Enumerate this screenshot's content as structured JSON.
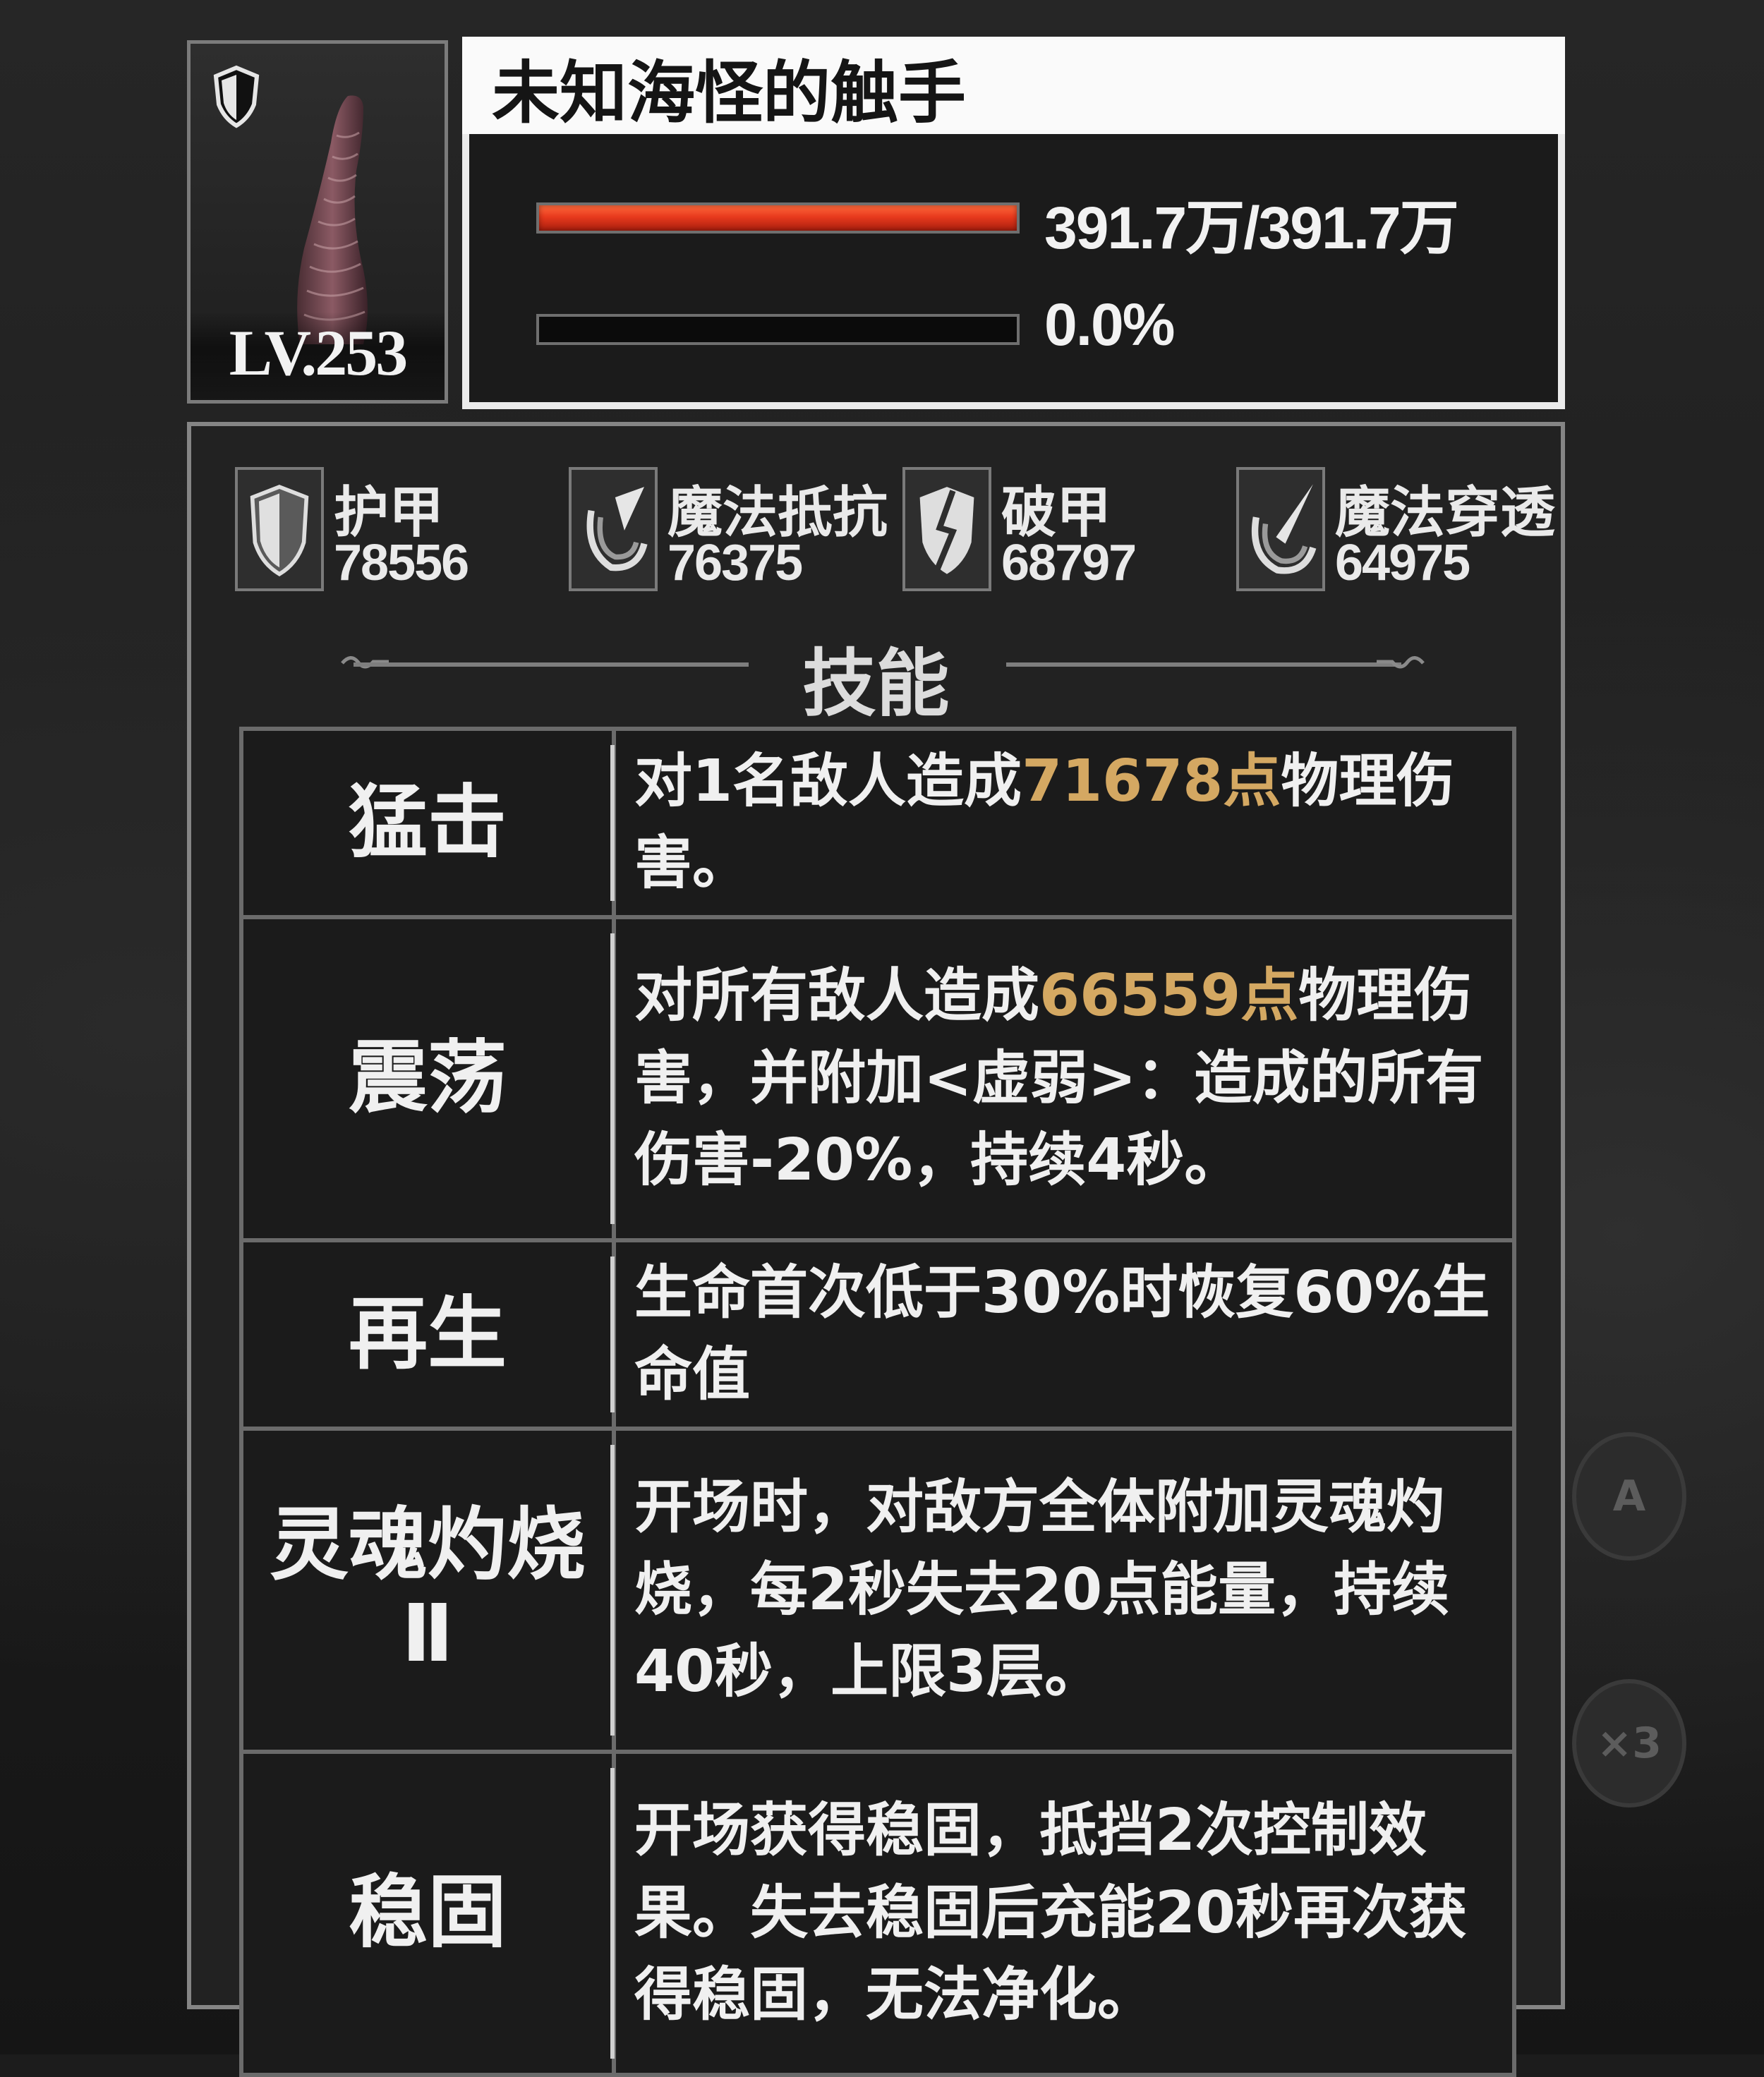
{
  "monster": {
    "name": "未知海怪的触手",
    "level": "LV.253",
    "hp_text": "391.7万/391.7万",
    "hp_fraction": 1.0,
    "energy_text": "0.0%",
    "energy_fraction": 0.0
  },
  "stats": [
    {
      "icon": "armor-shield-icon",
      "label": "护甲",
      "value": "78556"
    },
    {
      "icon": "magic-resist-icon",
      "label": "魔法抵抗",
      "value": "76375"
    },
    {
      "icon": "armor-break-icon",
      "label": "破甲",
      "value": "68797"
    },
    {
      "icon": "magic-penetration-icon",
      "label": "魔法穿透",
      "value": "64975"
    }
  ],
  "skills_heading": "技能",
  "skills": [
    {
      "name": "猛击",
      "desc_pre": "对1名敌人造成",
      "desc_hl": "71678点",
      "desc_post": "物理伤害。"
    },
    {
      "name": "震荡",
      "desc_pre": "对所有敌人造成",
      "desc_hl": "66559点",
      "desc_post": "物理伤害，并附加<虚弱>：造成的所有伤害-20%，持续4秒。"
    },
    {
      "name": "再生",
      "desc_pre": "生命首次低于30%时恢复60%生命值",
      "desc_hl": "",
      "desc_post": ""
    },
    {
      "name": "灵魂灼烧Ⅱ",
      "desc_pre": "开场时，对敌方全体附加灵魂灼烧，每2秒失去20点能量，持续40秒，上限3层。",
      "desc_hl": "",
      "desc_post": ""
    },
    {
      "name": "稳固",
      "desc_pre": "开场获得稳固，抵挡2次控制效果。失去稳固后充能20秒再次获得稳固，无法净化。",
      "desc_hl": "",
      "desc_post": ""
    }
  ],
  "colors": {
    "hp_fill": "#e83a1d",
    "highlight": "#d4a862",
    "panel_bg": "#222222",
    "name_bg": "#fafafa"
  }
}
